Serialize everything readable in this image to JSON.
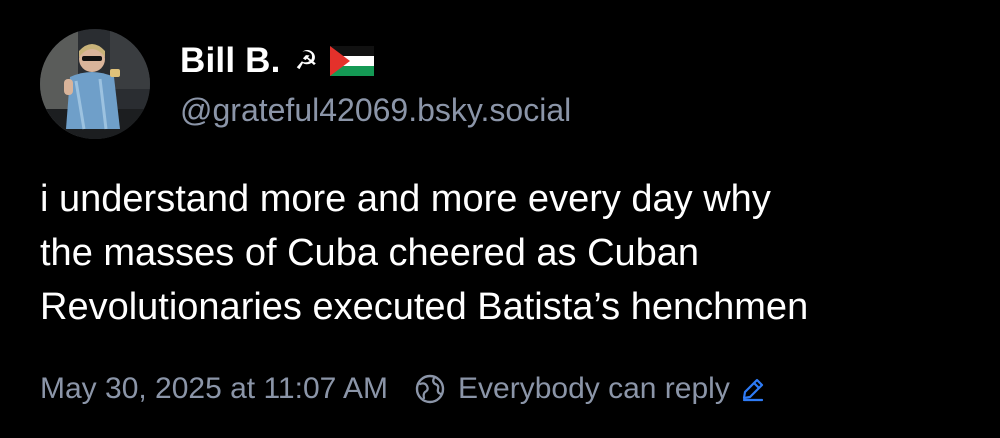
{
  "author": {
    "display_name": "Bill B.",
    "name_emoji": "☭",
    "flag": "palestine-flag",
    "handle": "@grateful42069.bsky.social"
  },
  "post": {
    "lines": [
      "i understand more and more every day why",
      "the masses of Cuba cheered as Cuban",
      "Revolutionaries executed Batista’s henchmen"
    ]
  },
  "meta": {
    "timestamp": "May 30, 2025 at 11:07 AM",
    "reply_setting": "Everybody can reply"
  },
  "icons": {
    "globe": "globe-icon",
    "edit": "pencil-icon"
  },
  "colors": {
    "background": "#000000",
    "text": "#ffffff",
    "muted": "#8b95a8",
    "accent": "#2e7bf6"
  }
}
